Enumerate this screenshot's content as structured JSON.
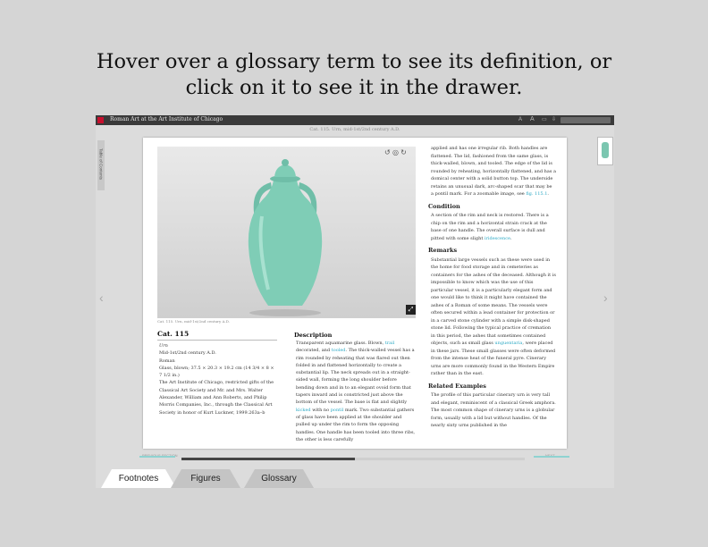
{
  "instruction": "Hover over a glossary term to see its definition, or click on it to see it in the drawer.",
  "app": {
    "title": "Roman Art at the Art Institute of Chicago",
    "page_subtitle": "Cat. 115. Urn, mid-1st/2nd century A.D.",
    "toc_label": "Table of Contents"
  },
  "toolbar": {
    "icons": [
      "text-smaller-icon",
      "text-larger-icon",
      "print-icon",
      "download-icon"
    ]
  },
  "image": {
    "caption": "Cat. 115. Urn, mid-1st/2nd century A.D.",
    "controls": [
      "rotate-left-icon",
      "360-view-icon",
      "rotate-right-icon"
    ]
  },
  "catalog": {
    "heading": "Cat. 115",
    "lines": [
      "Urn",
      "Mid-1st/2nd century A.D.",
      "Roman",
      "Glass, blown; 37.5 × 20.3 × 19.2 cm (14 3/4 × 8 × 7 1/2 in.)",
      "The Art Institute of Chicago, restricted gifts of the Classical Art Society and Mr. and Mrs. Walter Alexander, William and Ann Roberts, and Philip Morris Companies, Inc., through the Classical Art Society in honor of Kurt Luckner, 1999.263a–b"
    ]
  },
  "description": {
    "heading": "Description",
    "text_1": "Transparent aquamarine glass. Blown, ",
    "link_1": "trail",
    "text_2": " decorated, and ",
    "link_2": "tooled",
    "text_3": ". The thick-walled vessel has a rim rounded by reheating that was flared out then folded in and flattened horizontally to create a substantial lip. The neck spreads out in a straight-sided wall, forming the long shoulder before bending down and in to an elegant ovoid form that tapers inward and is constricted just above the bottom of the vessel. The base is flat and slightly ",
    "link_3": "kicked",
    "text_4": " with no ",
    "link_4": "pontil",
    "text_5": " mark. Two substantial gathers of glass have been applied at the shoulder and pulled up under the rim to form the opposing handles. One handle has been tooled into three ribs, the other is less carefully"
  },
  "right": {
    "desc_cont_1": "applied and has one irregular rib. Both handles are flattened. The lid, fashioned from the same glass, is thick-walled, blown, and tooled. The edge of the lid is rounded by reheating, horizontally flattened, and has a domical center with a solid button top. The underside retains an unusual dark, arc-shaped scar that may be a pontil mark. For a zoomable image, see ",
    "desc_link": "fig. 115.1",
    "desc_end": ".",
    "condition_heading": "Condition",
    "condition_1": "A section of the rim and neck is restored. There is a chip on the rim and a horizontal strain crack at the base of one handle. The overall surface is dull and pitted with some slight ",
    "condition_link": "iridescence",
    "condition_end": ".",
    "remarks_heading": "Remarks",
    "remarks_1": "Substantial large vessels such as these were used in the home for food storage and in cemeteries as containers for the ashes of the deceased. Although it is impossible to know which was the use of this particular vessel, it is a particularly elegant form and one would like to think it might have contained the ashes of a Roman of some means. The vessels were often secured within a lead container for protection or in a carved stone cylinder with a simple disk-shaped stone lid. Following the typical practice of cremation in this period, the ashes that sometimes contained objects, such as small glass ",
    "remarks_link": "unguentaria",
    "remarks_2": ", were placed in these jars. These small glasses were often deformed from the intense heat of the funeral pyre. Cinerary urns are more commonly found in the Western Empire rather than in the east.",
    "related_heading": "Related Examples",
    "related_1": "The profile of this particular cinerary urn is very tall and elegant, reminiscent of a classical Greek amphora. The most common shape of cinerary urns is a globular form, usually with a lid but without handles. Of the nearly sixty urns published in the"
  },
  "footer": {
    "prev_label": "PREVIOUS SECTION",
    "next_label": "NEXT",
    "progress": 0.505
  },
  "tabs": [
    {
      "label": "Footnotes"
    },
    {
      "label": "Figures"
    },
    {
      "label": "Glossary"
    }
  ],
  "colors": {
    "link": "#2aa8c4",
    "accent": "#8fd3d1",
    "glass": "#6fc3ad",
    "brand": "#c8102e"
  }
}
